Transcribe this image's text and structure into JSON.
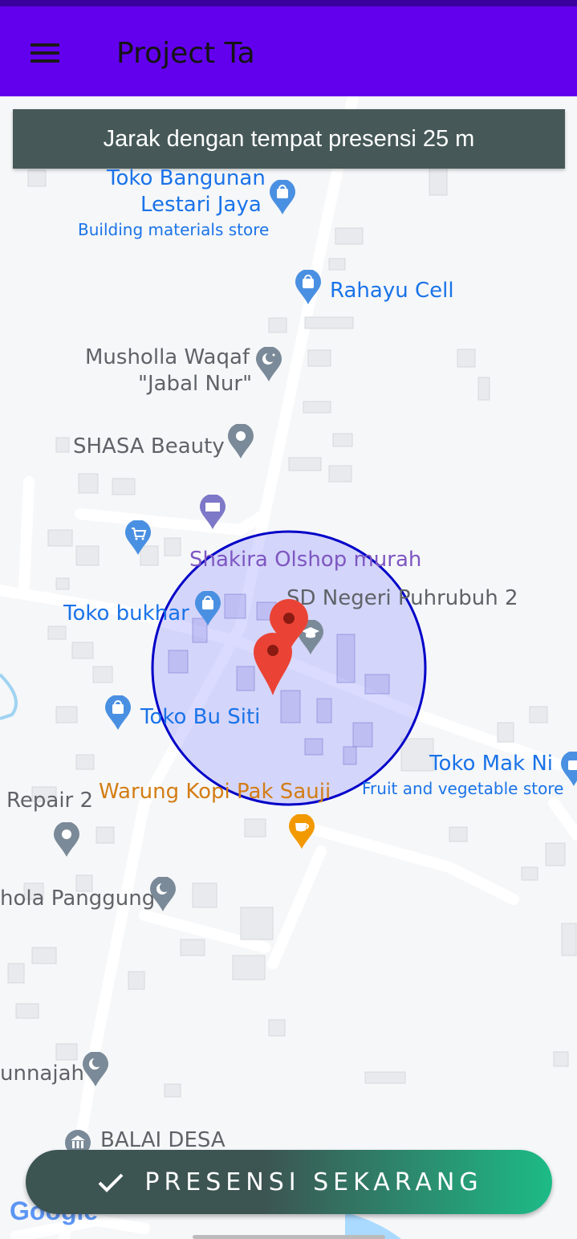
{
  "app": {
    "title": "Project Ta",
    "accent_color": "#6200ee"
  },
  "banner": {
    "text": "Jarak dengan tempat presensi 25 m"
  },
  "map": {
    "geofence_color": "#0000c8",
    "pois": [
      {
        "id": "toko-bangunan-1",
        "label": "Toko Bangunan"
      },
      {
        "id": "toko-bangunan-2",
        "label": "Lestari Jaya"
      },
      {
        "id": "toko-bangunan-3",
        "label": "Building materials store"
      },
      {
        "id": "rahayu-cell",
        "label": "Rahayu Cell"
      },
      {
        "id": "musholla-1",
        "label": "Musholla Waqaf"
      },
      {
        "id": "musholla-2",
        "label": "\"Jabal Nur\""
      },
      {
        "id": "shasa-beauty",
        "label": "SHASA Beauty"
      },
      {
        "id": "shakira-olshop",
        "label": "Shakira Olshop murah"
      },
      {
        "id": "sd-negeri",
        "label": "SD Negeri Puhrubuh 2"
      },
      {
        "id": "toko-bukhar",
        "label": "Toko bukhar"
      },
      {
        "id": "toko-bu-siti",
        "label": "Toko Bu Siti"
      },
      {
        "id": "toko-mak-ni",
        "label": "Toko Mak Ni"
      },
      {
        "id": "toko-mak-ni-sub",
        "label": "Fruit and vegetable store"
      },
      {
        "id": "repair-2",
        "label": "Repair 2"
      },
      {
        "id": "warung-kopi",
        "label": "Warung Kopi Pak Sauji"
      },
      {
        "id": "mushola-panggung",
        "label": "hola Panggung"
      },
      {
        "id": "unnajah",
        "label": "unnajah"
      },
      {
        "id": "balai-desa",
        "label": "BALAI DESA"
      }
    ],
    "attribution": "Google"
  },
  "action": {
    "label": "PRESENSI SEKARANG",
    "icon": "check-icon"
  }
}
